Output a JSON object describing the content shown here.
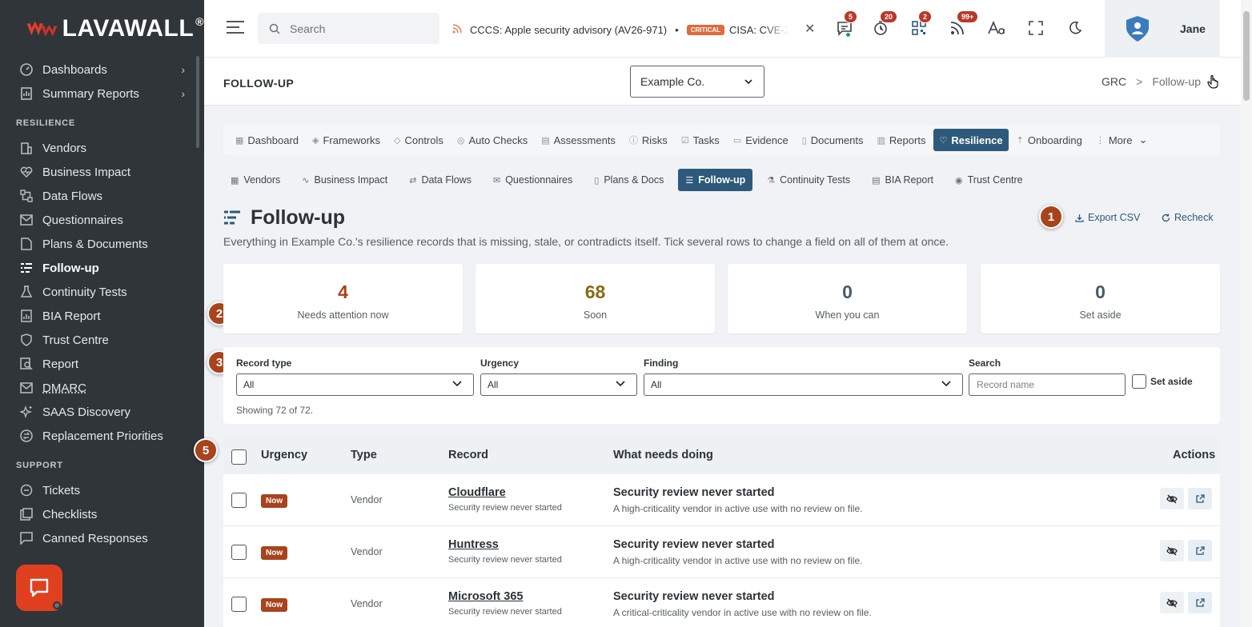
{
  "brand": {
    "logo_text": "LAVAWALL",
    "registered": "®"
  },
  "sidebar": {
    "top_items": [
      {
        "label": "Dashboards",
        "icon": "gauge-icon"
      },
      {
        "label": "Summary Reports",
        "icon": "report-icon"
      }
    ],
    "resilience_heading": "RESILIENCE",
    "resilience_items": [
      {
        "label": "Vendors",
        "icon": "building-icon"
      },
      {
        "label": "Business Impact",
        "icon": "heart-pulse-icon"
      },
      {
        "label": "Data Flows",
        "icon": "flow-icon"
      },
      {
        "label": "Questionnaires",
        "icon": "mail-icon"
      },
      {
        "label": "Plans & Documents",
        "icon": "document-icon"
      },
      {
        "label": "Follow-up",
        "icon": "list-check-icon"
      },
      {
        "label": "Continuity Tests",
        "icon": "flask-icon"
      },
      {
        "label": "BIA Report",
        "icon": "chart-doc-icon"
      },
      {
        "label": "Trust Centre",
        "icon": "shield-icon"
      },
      {
        "label": "Report",
        "icon": "search-doc-icon"
      },
      {
        "label": "DMARC",
        "icon": "mail-check-icon"
      },
      {
        "label": "SAAS Discovery",
        "icon": "sparkle-icon"
      },
      {
        "label": "Replacement Priorities",
        "icon": "swap-icon"
      }
    ],
    "support_heading": "SUPPORT",
    "support_items": [
      {
        "label": "Tickets",
        "icon": "ticket-icon"
      },
      {
        "label": "Checklists",
        "icon": "checklist-icon"
      },
      {
        "label": "Canned Responses",
        "icon": "chat-square-icon"
      }
    ]
  },
  "topbar": {
    "search_placeholder": "Search",
    "ticker_item1": "CCCS: Apple security advisory (AV26-971)",
    "ticker_sep": "•",
    "ticker_badge": "CRITICAL",
    "ticker_item2": "CISA: CVE-2",
    "close_glyph": "✕",
    "badges": {
      "messages": "5",
      "alerts": "20",
      "qr": "2",
      "feeds": "99+"
    },
    "user_name": "Jane"
  },
  "page_header": {
    "title": "FOLLOW-UP",
    "company": "Example Co.",
    "crumb_root": "GRC",
    "crumb_sep": ">",
    "crumb_current": "Follow-up"
  },
  "tabs_primary": [
    {
      "label": "Dashboard",
      "glyph": "▦"
    },
    {
      "label": "Frameworks",
      "glyph": "◈"
    },
    {
      "label": "Controls",
      "glyph": "◇"
    },
    {
      "label": "Auto Checks",
      "glyph": "◎"
    },
    {
      "label": "Assessments",
      "glyph": "▤"
    },
    {
      "label": "Risks",
      "glyph": "ⓘ"
    },
    {
      "label": "Tasks",
      "glyph": "☑"
    },
    {
      "label": "Evidence",
      "glyph": "▭"
    },
    {
      "label": "Documents",
      "glyph": "▯"
    },
    {
      "label": "Reports",
      "glyph": "▥"
    },
    {
      "label": "Resilience",
      "glyph": "♡"
    },
    {
      "label": "Onboarding",
      "glyph": "⇡"
    },
    {
      "label": "More",
      "glyph": "⋮",
      "chevron": "⌄"
    }
  ],
  "tabs_secondary": [
    {
      "label": "Vendors",
      "glyph": "▦"
    },
    {
      "label": "Business Impact",
      "glyph": "∿"
    },
    {
      "label": "Data Flows",
      "glyph": "⇄"
    },
    {
      "label": "Questionnaires",
      "glyph": "✉"
    },
    {
      "label": "Plans & Docs",
      "glyph": "▯"
    },
    {
      "label": "Follow-up",
      "glyph": "☰"
    },
    {
      "label": "Continuity Tests",
      "glyph": "⚗"
    },
    {
      "label": "BIA Report",
      "glyph": "▤"
    },
    {
      "label": "Trust Centre",
      "glyph": "◉"
    }
  ],
  "heading": {
    "title": "Follow-up",
    "subtitle": "Everything in Example Co.'s resilience records that is missing, stale, or contradicts itself. Tick several rows to change a field on all of them at once.",
    "export_label": "Export CSV",
    "recheck_label": "Recheck"
  },
  "markers": [
    "1",
    "2",
    "3",
    "5"
  ],
  "stats": [
    {
      "value": "4",
      "label": "Needs attention now",
      "color": "#a8431c"
    },
    {
      "value": "68",
      "label": "Soon",
      "color": "#8a6a12"
    },
    {
      "value": "0",
      "label": "When you can",
      "color": "#4a5a6a"
    },
    {
      "value": "0",
      "label": "Set aside",
      "color": "#4a5a6a"
    }
  ],
  "filters": {
    "record_type_label": "Record type",
    "record_type_value": "All",
    "urgency_label": "Urgency",
    "urgency_value": "All",
    "finding_label": "Finding",
    "finding_value": "All",
    "search_label": "Search",
    "search_placeholder": "Record name",
    "set_aside_label": "Set aside",
    "showing": "Showing 72 of 72."
  },
  "table": {
    "columns": {
      "urgency": "Urgency",
      "type": "Type",
      "record": "Record",
      "what": "What needs doing",
      "actions": "Actions"
    },
    "rows": [
      {
        "urgency": "Now",
        "type": "Vendor",
        "name": "Cloudflare",
        "sub": "Security review never started",
        "title": "Security review never started",
        "desc": "A high-criticality vendor in active use with no review on file."
      },
      {
        "urgency": "Now",
        "type": "Vendor",
        "name": "Huntress",
        "sub": "Security review never started",
        "title": "Security review never started",
        "desc": "A high-criticality vendor in active use with no review on file."
      },
      {
        "urgency": "Now",
        "type": "Vendor",
        "name": "Microsoft 365",
        "sub": "Security review never started",
        "title": "Security review never started",
        "desc": "A critical-criticality vendor in active use with no review on file."
      }
    ]
  },
  "colors": {
    "accent": "#2d5a7b",
    "sidebar": "#2f3538",
    "marker": "#a8431c",
    "brand_red": "#e0401f"
  }
}
